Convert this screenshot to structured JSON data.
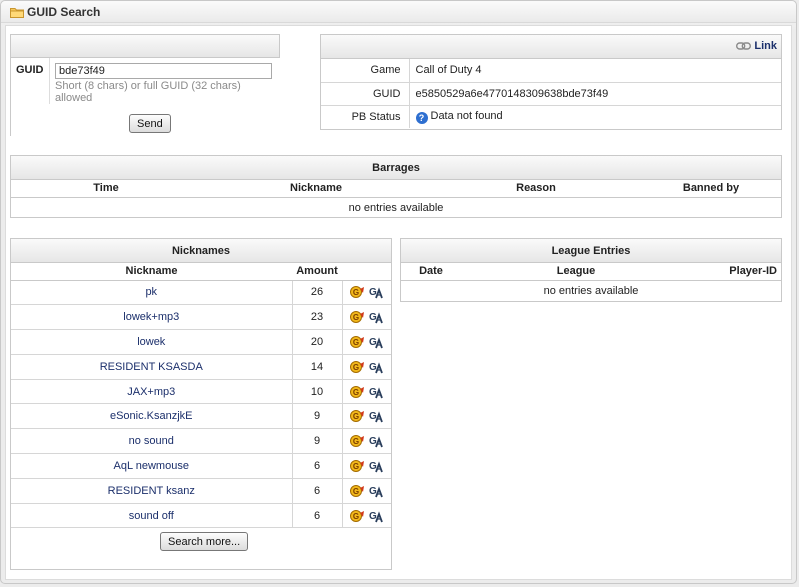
{
  "window": {
    "title": "GUID Search",
    "icon": "folder-icon"
  },
  "form": {
    "label": "GUID",
    "value": "bde73f49",
    "hint": "Short (8 chars) or full GUID (32 chars) allowed",
    "send_label": "Send"
  },
  "info": {
    "link_label": "Link",
    "rows": [
      {
        "key": "Game",
        "value": "Call of Duty 4"
      },
      {
        "key": "GUID",
        "value": "e5850529a6e477014830963 8bde73f49"
      },
      {
        "key": "PB Status",
        "value": "Data not found"
      }
    ]
  },
  "barrages": {
    "title": "Barrages",
    "columns": [
      "Time",
      "Nickname",
      "Reason",
      "Banned by"
    ],
    "empty": "no entries available"
  },
  "nicknames": {
    "title": "Nicknames",
    "columns": [
      "Nickname",
      "Amount",
      ""
    ],
    "rows": [
      {
        "name": "pk",
        "amount": "26"
      },
      {
        "name": "lowek+mp3",
        "amount": "23"
      },
      {
        "name": "lowek",
        "amount": "20"
      },
      {
        "name": "RESIDENT KSASDA",
        "amount": "14"
      },
      {
        "name": "JAX+mp3",
        "amount": "10"
      },
      {
        "name": "eSonic.KsanzjkE",
        "amount": "9"
      },
      {
        "name": "no sound",
        "amount": "9"
      },
      {
        "name": "AqL newmouse",
        "amount": "6"
      },
      {
        "name": "RESIDENT ksanz",
        "amount": "6"
      },
      {
        "name": "sound off",
        "amount": "6"
      }
    ],
    "more_label": "Search more..."
  },
  "league": {
    "title": "League Entries",
    "columns": [
      "Date",
      "League",
      "Player-ID"
    ],
    "empty": "no entries available"
  },
  "colors": {
    "link": "#1b2f6b",
    "info_icon": "#2e6fd0"
  }
}
